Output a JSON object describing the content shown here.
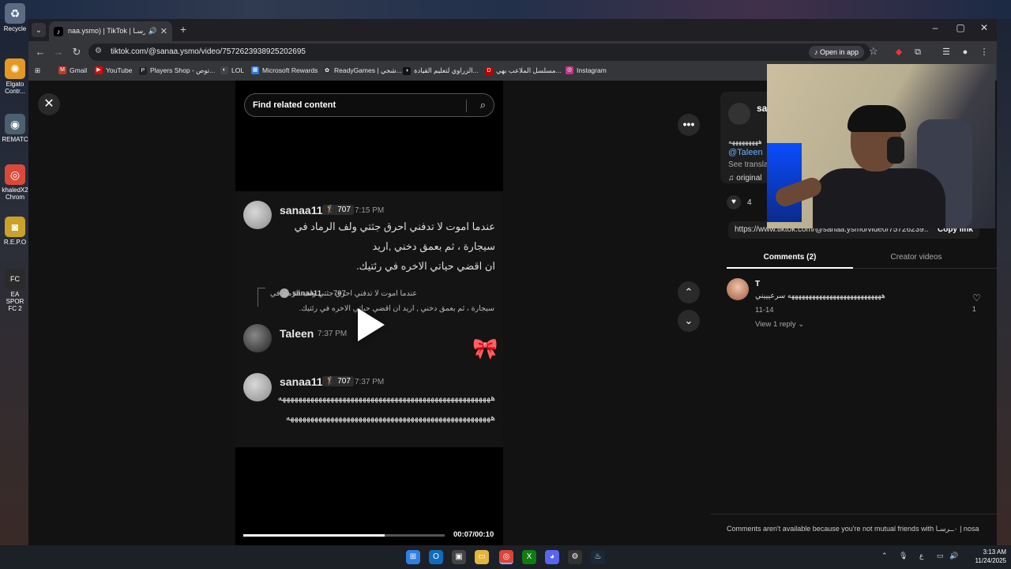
{
  "desktop": {
    "icons": [
      {
        "label": "Recycle",
        "glyph": "♻",
        "color": "#5c6b84"
      },
      {
        "label": "Elgato Contr...",
        "glyph": "✺",
        "color": "#e29a23"
      },
      {
        "label": "REMATC",
        "glyph": "◉",
        "color": "#4d6070"
      },
      {
        "label": "khaledX2 Chrom",
        "glyph": "◎",
        "color": "#d94a3a"
      },
      {
        "label": "R.E.P.O",
        "glyph": "◙",
        "color": "#c9a227"
      },
      {
        "label": "EA SPOR FC 2",
        "glyph": "FC",
        "color": "#2a2a2a"
      }
    ]
  },
  "browser": {
    "tab_title": "naa.ysmo) | TikTok | ٠ــرسـا",
    "url": "tiktok.com/@sanaa.ysmo/video/7572623938925202695",
    "open_in_app": "Open in app",
    "bookmarks": [
      "Gmail",
      "YouTube",
      "Players Shop - توص...",
      "LOL",
      "Microsoft Rewards",
      "ReadyGames | شجي...",
      "الزراوي لتعليم القيادة...",
      "مسلسل الملاعب بهي...",
      "Instagram"
    ]
  },
  "video": {
    "search_placeholder": "Find related content",
    "messages": [
      {
        "name": "sanaa11",
        "badge": "🏌 707",
        "time": "7:15 PM",
        "text": [
          "عندما اموت لا تدفني احرق جثتي ولف الرماد في",
          "سيجارة ، ثم بعمق دخني ,اريد",
          "ان اقضي حياتي الاخره في رئتيك."
        ]
      },
      {
        "quote_name": "sanaa11",
        "quote_badge": "707",
        "quote_line1": "عندما اموت لا تدفني احرق جثتي ولف الرماد في",
        "quote_line2": "سيجارة ، ثم بعمق دخني , اريد ان اقضي حياتي الاخره في رئتيك."
      },
      {
        "name": "Taleen",
        "time": "7:37 PM",
        "emoji": "🎀"
      },
      {
        "name": "sanaa11",
        "badge": "🏌 707",
        "time": "7:37 PM",
        "text": [
          "هههههههههههههههههههههههههههههههههههههههههههههههههههههه",
          "هههههههههههههههههههههههههههههههههههههههههههههههههههه"
        ]
      }
    ],
    "time": "00:07/00:10",
    "progress": 0.7
  },
  "panel": {
    "author_initial": "sa",
    "desc": "هههههههههه",
    "mention": "@Taleen",
    "see_translation": "See transla",
    "original_sound": "♫ original",
    "likes": "4",
    "link_url": "https://www.tiktok.com/@sanaa.ysmo/video/75726239...",
    "copy_link": "Copy link",
    "tab_comments": "Comments (2)",
    "tab_creator": "Creator videos",
    "comment": {
      "user": "T",
      "text": "هههههههههههههههههههههههههههه سرعيييني",
      "date": "11-14",
      "reply": "View 1 reply ⌄",
      "like_count": "1"
    },
    "footer_text": "Comments aren't available because you're not mutual friends with ٠ــرسـا | nosa"
  },
  "taskbar": {
    "lang": "ع",
    "time": "3:13 AM",
    "date": "11/24/2025"
  },
  "colors": {
    "accent_link": "#6ab4ff",
    "tiktok_bg": "#121212"
  }
}
